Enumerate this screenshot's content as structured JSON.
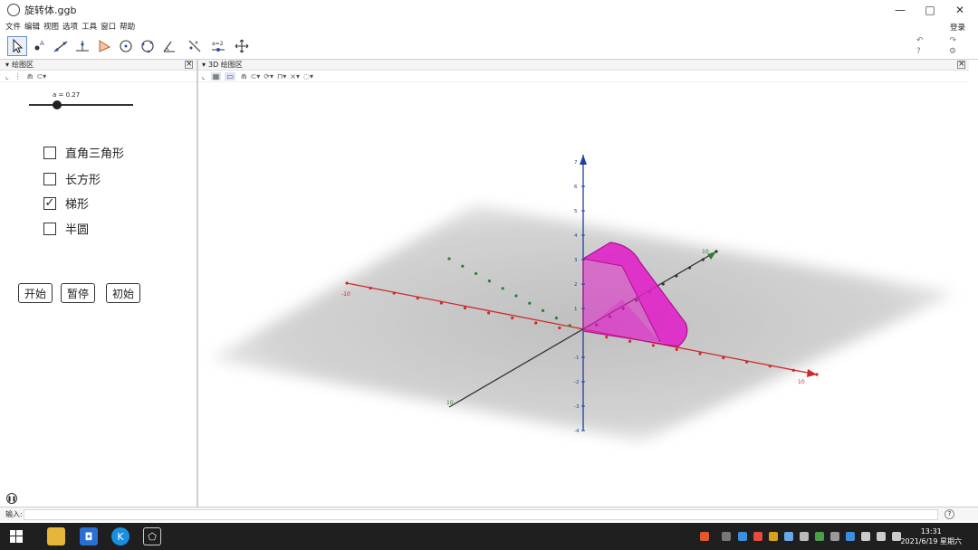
{
  "window": {
    "title": "旋转体.ggb",
    "controls": {
      "minimize": "—",
      "maximize": "□",
      "close": "✕"
    }
  },
  "menu": [
    "文件",
    "编辑",
    "视图",
    "选项",
    "工具",
    "窗口",
    "帮助"
  ],
  "login_label": "登录",
  "toolbar": {
    "tools": [
      "move-tool",
      "point-tool",
      "line-tool",
      "perpendicular-line-tool",
      "polygon-tool",
      "circle-tool",
      "circle-three-points-tool",
      "angle-tool",
      "reflect-tool",
      "slider-tool",
      "move-graphics-view-tool"
    ],
    "active_tool": "move-tool",
    "slider_tool_label": "a=2"
  },
  "left_panel": {
    "title": "绘图区",
    "slider": {
      "label": "a = 0.27",
      "value_fraction": 0.27
    },
    "checkboxes": [
      {
        "label": "直角三角形",
        "checked": false
      },
      {
        "label": "长方形",
        "checked": false
      },
      {
        "label": "梯形",
        "checked": true
      },
      {
        "label": "半圆",
        "checked": false
      }
    ],
    "buttons": {
      "start": "开始",
      "pause": "暂停",
      "reset": "初始"
    }
  },
  "view3d": {
    "title": "3D 绘图区",
    "colors": {
      "x_axis": "#cc2a2a",
      "y_axis": "#2e7d32",
      "z_axis": "#1f3f9e",
      "solid": "#e020c8"
    },
    "tick_labels": {
      "x_negative": "-10",
      "x_positive": "10",
      "y_positive": "10",
      "y_negative": "10",
      "z": [
        "7",
        "6",
        "5",
        "4",
        "3",
        "2",
        "1",
        "-1",
        "-2",
        "-3",
        "-4"
      ]
    }
  },
  "input_bar": {
    "label": "输入:",
    "value": ""
  },
  "taskbar": {
    "time": "13:31",
    "date": "2021/6/19 星期六"
  }
}
